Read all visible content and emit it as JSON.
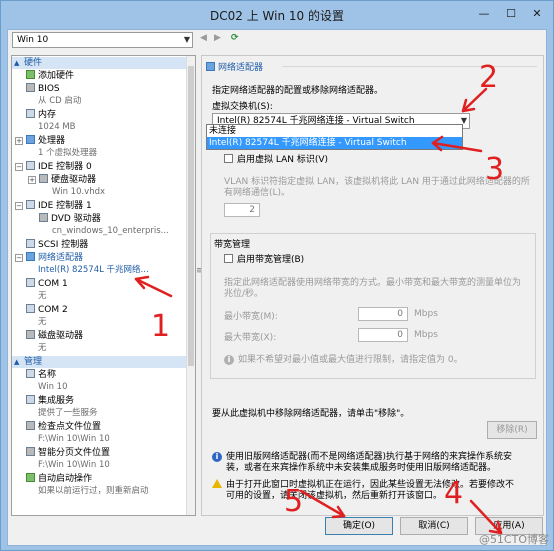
{
  "window": {
    "title": "DC02 上 Win 10 的设置",
    "minimize": "—",
    "maximize": "☐",
    "close": "✕"
  },
  "vm_select": {
    "value": "Win 10"
  },
  "tree": {
    "hardware_header": "硬件",
    "add_hardware": "添加硬件",
    "bios": "BIOS",
    "bios_sub": "从 CD 启动",
    "memory": "内存",
    "memory_sub": "1024 MB",
    "processor": "处理器",
    "processor_sub": "1 个虚拟处理器",
    "ide0": "IDE 控制器 0",
    "hdd": "硬盘驱动器",
    "hdd_sub": "Win 10.vhdx",
    "ide1": "IDE 控制器 1",
    "dvd": "DVD 驱动器",
    "dvd_sub": "cn_windows_10_enterpris...",
    "scsi": "SCSI 控制器",
    "nic": "网络适配器",
    "nic_sub": "Intel(R) 82574L 千兆网络...",
    "com1": "COM 1",
    "com1_sub": "无",
    "com2": "COM 2",
    "com2_sub": "无",
    "floppy": "磁盘驱动器",
    "floppy_sub": "无",
    "mgmt_header": "管理",
    "name": "名称",
    "name_sub": "Win 10",
    "integration": "集成服务",
    "integration_sub": "提供了一些服务",
    "checkpoint": "检查点文件位置",
    "checkpoint_sub": "F:\\Win 10\\Win 10",
    "paging": "智能分页文件位置",
    "paging_sub": "F:\\Win 10\\Win 10",
    "autostart": "自动启动操作",
    "autostart_sub": "如果以前运行过，则重新启动"
  },
  "panel": {
    "section_title": "网络适配器",
    "description": "指定网络适配器的配置或移除网络适配器。",
    "vswitch_label": "虚拟交换机(S):",
    "vswitch_value": "Intel(R) 82574L 千兆网络连接 - Virtual Switch",
    "options": [
      "未连接",
      "Intel(R) 82574L 千兆网络连接 - Virtual Switch"
    ],
    "vlan_checkbox": "启用虚拟 LAN 标识(V)",
    "vlan_desc_1": "VLAN 标识符指定虚拟 LAN，该虚拟机将此 LAN 用于通过此网络适配器的所",
    "vlan_desc_2": "有网络通信(L)。",
    "vlan_value": "2",
    "bw_title": "带宽管理",
    "bw_checkbox": "启用带宽管理(B)",
    "bw_desc_1": "指定此网络适配器使用网络带宽的方式。最小带宽和最大带宽的测量单位为",
    "bw_desc_2": "兆位/秒。",
    "min_bw_label": "最小带宽(M):",
    "min_bw_value": "0",
    "max_bw_label": "最大带宽(X):",
    "max_bw_value": "0",
    "unit": "Mbps",
    "bw_info": "如果不希望对最小值或最大值进行限制，请指定值为 0。",
    "remove_desc": "要从此虚拟机中移除网络适配器，请单击\"移除\"。",
    "remove_button": "移除(R)",
    "legacy_1": "使用旧版网络适配器(而不是网络适配器)执行基于网络的来宾操作系统安",
    "legacy_2": "装，或者在来宾操作系统中未安装集成服务时使用旧版网络适配器。",
    "warn_1": "由于打开此窗口时虚拟机正在运行，因此某些设置无法修改。若要修改不",
    "warn_2": "可用的设置，请关闭该虚拟机，然后重新打开该窗口。"
  },
  "buttons": {
    "ok": "确定(O)",
    "cancel": "取消(C)",
    "apply": "应用(A)"
  },
  "annotations": {
    "n1": "1",
    "n2": "2",
    "n3": "3",
    "n4": "4",
    "n5": "5",
    "color": "#e02020"
  },
  "watermark": "@51CTO博客"
}
